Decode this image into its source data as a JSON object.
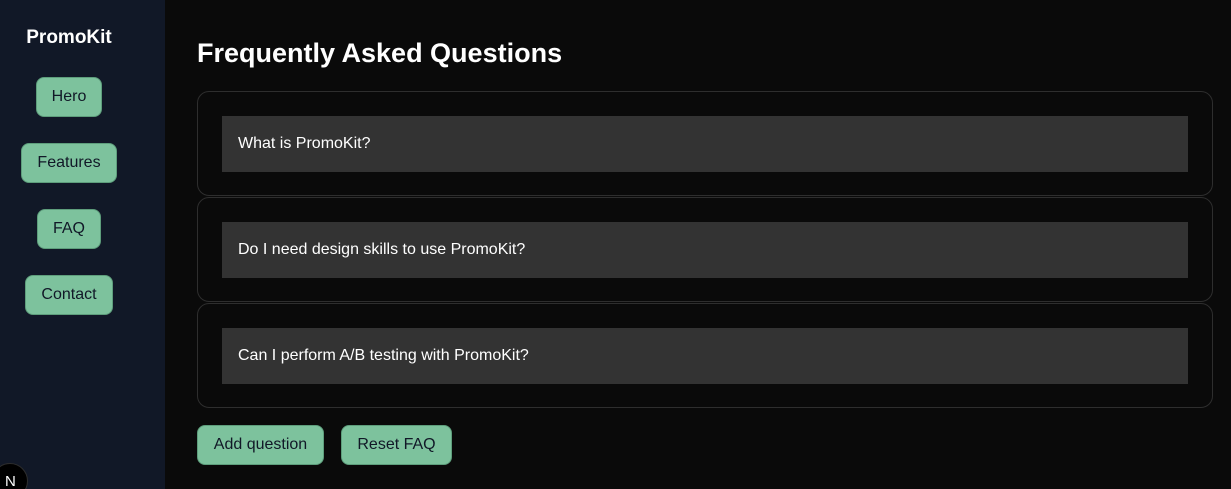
{
  "sidebar": {
    "brand": "PromoKit",
    "items": [
      {
        "label": "Hero"
      },
      {
        "label": "Features"
      },
      {
        "label": "FAQ"
      },
      {
        "label": "Contact"
      }
    ]
  },
  "main": {
    "title": "Frequently Asked Questions",
    "faq": [
      {
        "question": "What is PromoKit?"
      },
      {
        "question": "Do I need design skills to use PromoKit?"
      },
      {
        "question": "Can I perform A/B testing with PromoKit?"
      }
    ],
    "actions": {
      "add_label": "Add question",
      "reset_label": "Reset FAQ"
    }
  },
  "badge": {
    "letter": "N"
  },
  "colors": {
    "sidebar_bg": "#111827",
    "page_bg": "#0a0a0a",
    "accent": "#7dc29d",
    "question_bg": "#333333"
  }
}
